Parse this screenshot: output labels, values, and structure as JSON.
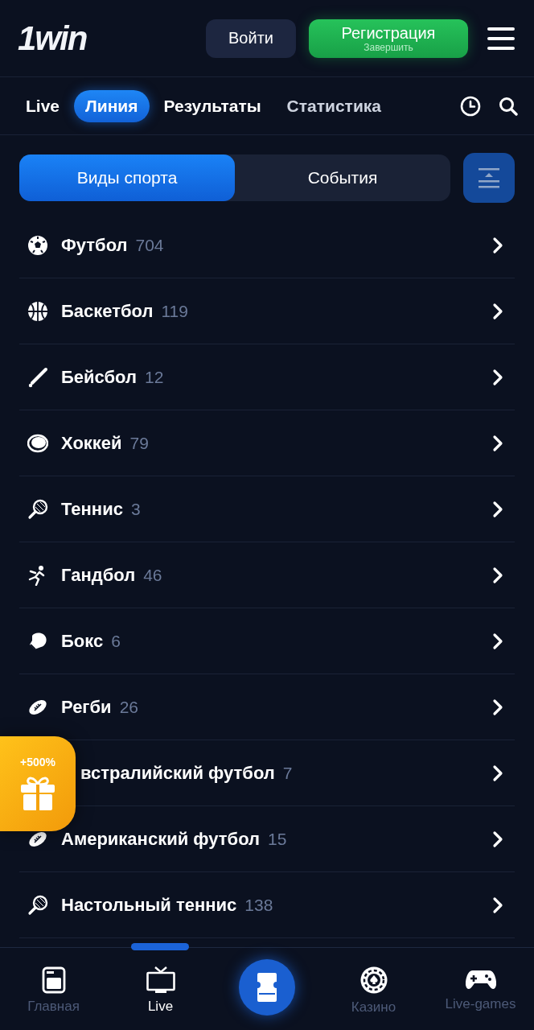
{
  "header": {
    "logo": "1win",
    "login_button": "Войти",
    "register_button": {
      "label": "Регистрация",
      "sublabel": "Завершить"
    }
  },
  "tabs": [
    {
      "label": "Live",
      "selected": false
    },
    {
      "label": "Линия",
      "selected": true
    },
    {
      "label": "Результаты",
      "selected": false
    },
    {
      "label": "Статистика",
      "selected": false
    }
  ],
  "segments": [
    {
      "label": "Виды спорта",
      "selected": true
    },
    {
      "label": "События",
      "selected": false
    }
  ],
  "sports": [
    {
      "name": "Футбол",
      "count": "704"
    },
    {
      "name": "Баскетбол",
      "count": "119"
    },
    {
      "name": "Бейсбол",
      "count": "12"
    },
    {
      "name": "Хоккей",
      "count": "79"
    },
    {
      "name": "Теннис",
      "count": "3"
    },
    {
      "name": "Гандбол",
      "count": "46"
    },
    {
      "name": "Бокс",
      "count": "6"
    },
    {
      "name": "Регби",
      "count": "26"
    },
    {
      "name": "встралийский футбол",
      "count": "7"
    },
    {
      "name": "Американский футбол",
      "count": "15"
    },
    {
      "name": "Настольный теннис",
      "count": "138"
    }
  ],
  "promo_badge": "+500%",
  "bottom_nav": [
    {
      "kind": "home",
      "label": "Главная",
      "selected": false
    },
    {
      "kind": "tv",
      "label": "Live",
      "selected": true
    },
    {
      "kind": "ticket",
      "selected": false
    },
    {
      "kind": "chip",
      "label": "Казино",
      "selected": false
    },
    {
      "kind": "gamepad",
      "label": "Live-games",
      "selected": false
    }
  ]
}
